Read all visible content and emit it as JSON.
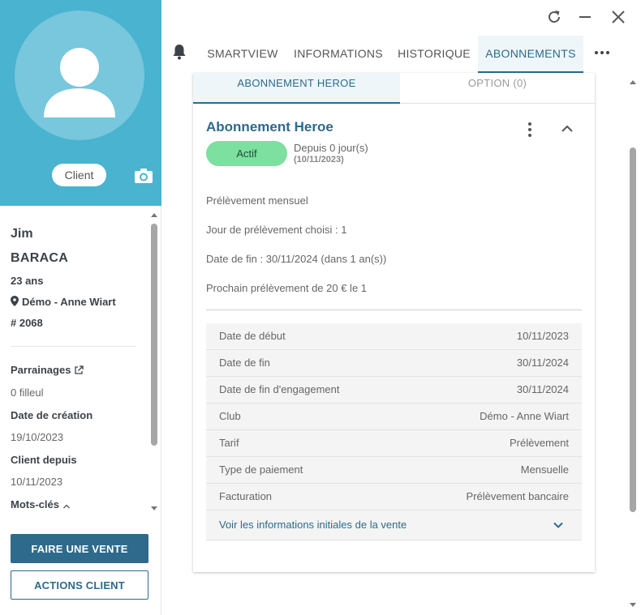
{
  "profile": {
    "badge": "Client",
    "first_name": "Jim",
    "last_name": "BARACA",
    "age": "23 ans",
    "club": "Démo - Anne Wiart",
    "member_id": "# 2068",
    "fields": [
      {
        "label": "Parrainages",
        "value": "0 filleul"
      },
      {
        "label": "Date de création",
        "value": "19/10/2023"
      },
      {
        "label": "Client depuis",
        "value": "10/11/2023"
      },
      {
        "label": "Mots-clés"
      }
    ]
  },
  "actions": {
    "primary": "FAIRE UNE VENTE",
    "secondary": "ACTIONS CLIENT"
  },
  "tabs": [
    {
      "label": "SMARTVIEW"
    },
    {
      "label": "INFORMATIONS"
    },
    {
      "label": "HISTORIQUE"
    },
    {
      "label": "ABONNEMENTS",
      "active": true
    }
  ],
  "subtabs": [
    {
      "label": "ABONNEMENT HEROE",
      "active": true
    },
    {
      "label": "OPTION (0)"
    }
  ],
  "subscription": {
    "title": "Abonnement Heroe",
    "status": "Actif",
    "since": "Depuis 0 jour(s)",
    "since_date": "(10/11/2023)",
    "details": [
      "Prélèvement mensuel",
      "Jour de prélèvement choisi : 1",
      "Date de fin : 30/11/2024 (dans 1 an(s))",
      "Prochain prélèvement de 20 € le 1"
    ],
    "rows": [
      {
        "label": "Date de début",
        "value": "10/11/2023"
      },
      {
        "label": "Date de fin",
        "value": "30/11/2024"
      },
      {
        "label": "Date de fin d'engagement",
        "value": "30/11/2024"
      },
      {
        "label": "Club",
        "value": "Démo - Anne Wiart"
      },
      {
        "label": "Tarif",
        "value": "Prélèvement"
      },
      {
        "label": "Type de paiement",
        "value": "Mensuelle"
      },
      {
        "label": "Facturation",
        "value": "Prélèvement bancaire"
      }
    ],
    "more_link": "Voir les informations initiales de la vente"
  },
  "colors": {
    "header_bg": "#4ab3cf",
    "primary": "#2d6a8c",
    "status_green": "#7ddfa0"
  }
}
